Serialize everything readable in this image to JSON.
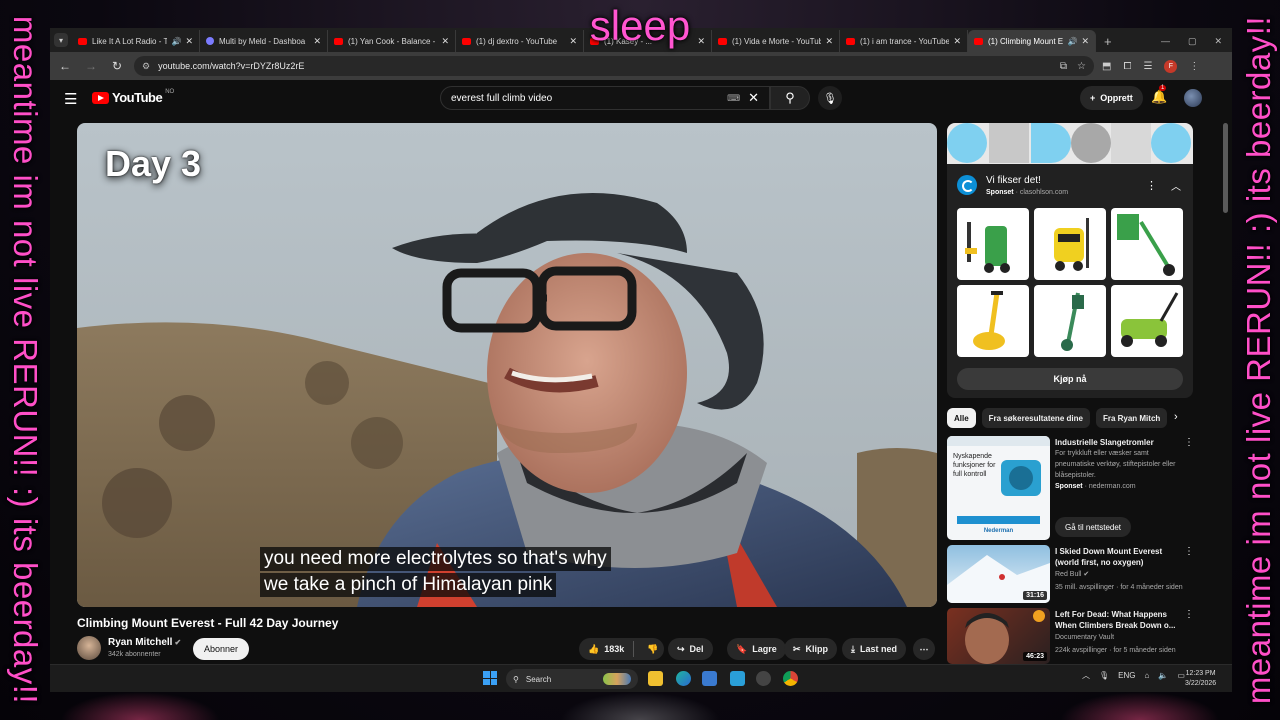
{
  "overlay": {
    "side_text": "meantime im not live RERUN!! :) its beerday!!",
    "top_text": "sleep"
  },
  "browser": {
    "tabs": [
      {
        "title": "Like It A Lot Radio - T",
        "icon": "youtube-favicon",
        "audio": true
      },
      {
        "title": "Multi by Meld - Dashboa",
        "icon": "meld-favicon",
        "audio": false
      },
      {
        "title": "(1) Yan Cook - Balance - Y",
        "icon": "youtube-favicon",
        "audio": false
      },
      {
        "title": "(1) dj dextro - YouTube",
        "icon": "youtube-favicon",
        "audio": false
      },
      {
        "title": "(1) Kasey - ...",
        "icon": "youtube-favicon",
        "audio": false
      },
      {
        "title": "(1) Vida e Morte - YouTub",
        "icon": "youtube-favicon",
        "audio": false
      },
      {
        "title": "(1) i am trance - YouTube",
        "icon": "youtube-favicon",
        "audio": false
      },
      {
        "title": "(1) Climbing Mount E",
        "icon": "youtube-favicon",
        "audio": true,
        "active": true
      }
    ],
    "url": "youtube.com/watch?v=rDYZr8Uz2rE",
    "profile_initial": "F"
  },
  "youtube": {
    "logo_text": "YouTube",
    "region": "NO",
    "search_query": "everest full climb video",
    "create_label": "Opprett",
    "notification_count": "1"
  },
  "video": {
    "overlay_title": "Day 3",
    "captions": [
      "you need more electrolytes so that's why",
      "we take a pinch of Himalayan pink"
    ],
    "title": "Climbing Mount Everest - Full 42 Day Journey",
    "channel": "Ryan Mitchell",
    "subscribers": "342k abonnenter",
    "subscribe_label": "Abonner",
    "likes": "183k",
    "share_label": "Del",
    "save_label": "Lagre",
    "clip_label": "Klipp",
    "download_label": "Last ned"
  },
  "ad": {
    "title": "Vi fikser det!",
    "sponsored": "Sponset",
    "domain": "clasohlson.com",
    "cta": "Kjøp nå"
  },
  "chips": [
    "Alle",
    "Fra søkeresultatene dine",
    "Fra Ryan Mitch"
  ],
  "recommendations": [
    {
      "title": "Industrielle Slangetromler",
      "body": "For trykkluft eller væsker samt pneumatiske verktøy, stiftepistoler eller blåsepistoler.",
      "sponsored": "Sponset",
      "domain": "nederman.com",
      "cta": "Gå til nettstedet",
      "thumb_text": "Nyskapende funksjoner for full kontroll",
      "thumb_brand": "Nederman"
    },
    {
      "title": "I Skied Down Mount Everest (world first, no oxygen)",
      "channel": "Red Bull",
      "meta": "35 mill. avspillinger · for 4 måneder siden",
      "duration": "31:16"
    },
    {
      "title": "Left For Dead: What Happens When Climbers Break Down o...",
      "channel": "Documentary Vault",
      "meta": "224k avspillinger · for 5 måneder siden",
      "duration": "46:23"
    }
  ],
  "taskbar": {
    "search_label": "Search",
    "language": "ENG",
    "time": "12:23 PM",
    "date": "3/22/2026"
  }
}
